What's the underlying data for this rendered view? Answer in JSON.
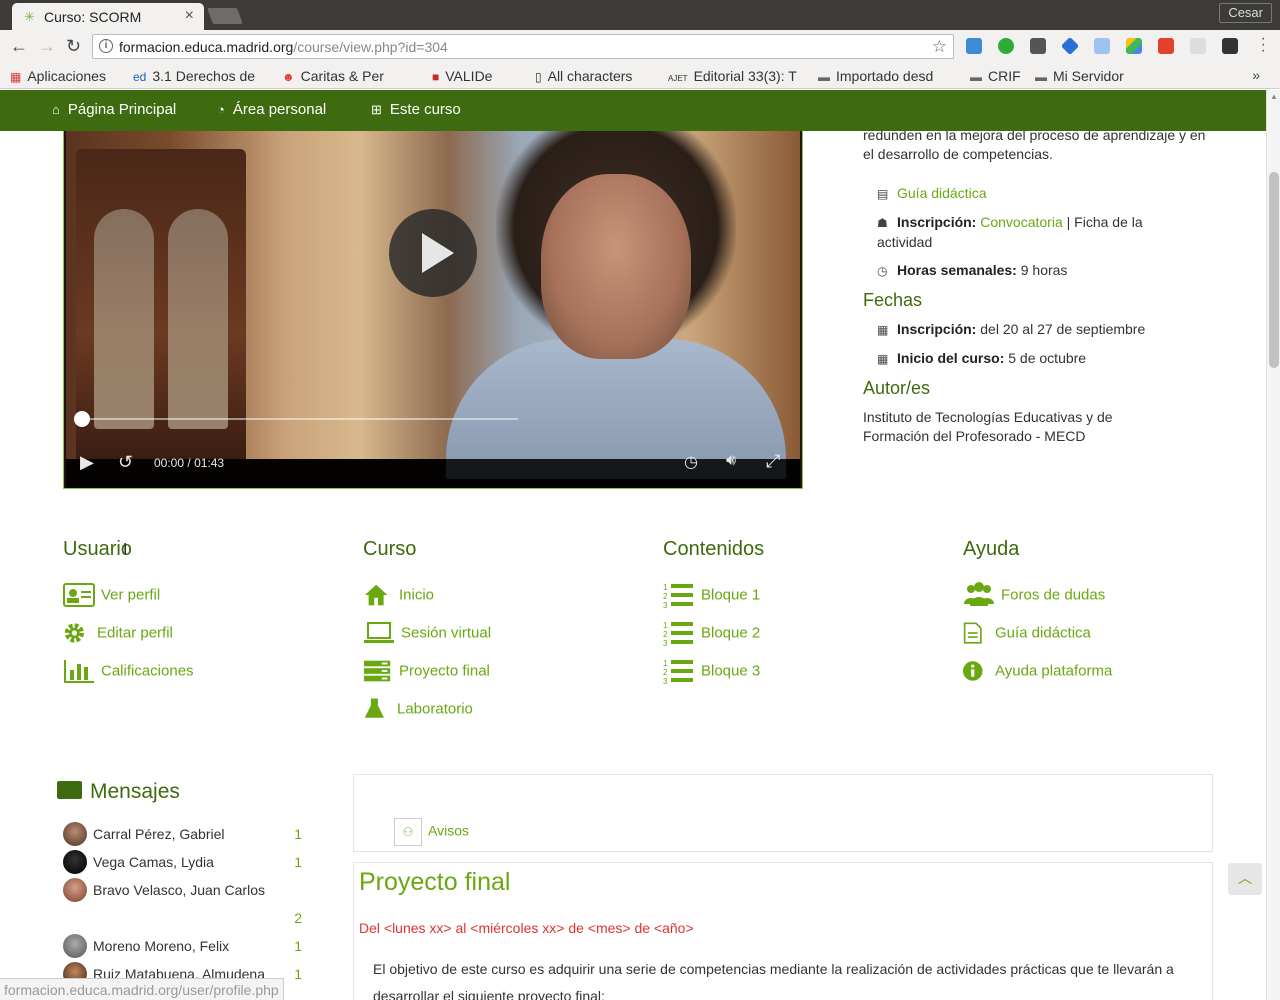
{
  "browser": {
    "tab_title": "Curso: SCORM",
    "tab_close": "×",
    "user": "Cesar",
    "url_host": "formacion.educa.madrid.org",
    "url_path": "/course/view.php?id=304",
    "bookmarks": [
      "Aplicaciones",
      "3.1 Derechos de",
      "Caritas & Per",
      "VALIDe",
      "All characters",
      "Editorial 33(3): T",
      "Importado desd",
      "CRIF",
      "Mi Servidor"
    ],
    "status_url": "formacion.educa.madrid.org/user/profile.php"
  },
  "nav": {
    "home": "Página Principal",
    "personal": "Área personal",
    "course": "Este curso"
  },
  "video": {
    "current_time": "00:00",
    "separator": "/",
    "duration": "01:43",
    "progress": 0
  },
  "info": {
    "intro": "redunden en la mejora del proceso de aprendizaje y en el desarrollo de competencias.",
    "guide_link": "Guía didáctica",
    "inscripcion_label": "Inscripción:",
    "convocatoria": "Convocatoria",
    "sep": "|",
    "ficha": "Ficha de la actividad",
    "horas_label": "Horas semanales:",
    "horas_value": "9 horas",
    "fechas_heading": "Fechas",
    "fecha_insc_label": "Inscripción:",
    "fecha_insc_value": "del 20 al 27 de septiembre",
    "inicio_label": "Inicio del curso:",
    "inicio_value": "5 de octubre",
    "autor_heading": "Autor/es",
    "autor_value": "Instituto de Tecnologías Educativas y de Formación del Profesorado - MECD"
  },
  "quicklinks": {
    "usuario": {
      "heading": "Usuario",
      "items": [
        "Ver perfil",
        "Editar perfil",
        "Calificaciones"
      ]
    },
    "curso": {
      "heading": "Curso",
      "items": [
        "Inicio",
        "Sesión virtual",
        "Proyecto final",
        "Laboratorio"
      ]
    },
    "contenidos": {
      "heading": "Contenidos",
      "items": [
        "Bloque 1",
        "Bloque 2",
        "Bloque 3"
      ]
    },
    "ayuda": {
      "heading": "Ayuda",
      "items": [
        "Foros de dudas",
        "Guía didáctica",
        "Ayuda plataforma"
      ]
    }
  },
  "messages": {
    "heading": "Mensajes",
    "rows": [
      {
        "name": "Carral Pérez, Gabriel",
        "count": "1"
      },
      {
        "name": "Vega Camas, Lydia",
        "count": "1"
      },
      {
        "name": "Bravo Velasco, Juan Carlos",
        "count": "2"
      },
      {
        "name": "Moreno Moreno, Felix",
        "count": "1"
      },
      {
        "name": "Ruiz Matabuena, Almudena",
        "count": "1"
      }
    ]
  },
  "course": {
    "avisos": "Avisos",
    "title": "Proyecto final",
    "dates": "Del <lunes xx> al <miércoles xx> de <mes> de <año>",
    "text": "El objetivo de este curso es adquirir una serie de competencias mediante la realización de actividades prácticas que te llevarán a desarrollar el siguiente proyecto final:"
  },
  "colors": {
    "nav_green": "#3e6b0f",
    "link_green": "#6aa812",
    "red": "#e03333"
  }
}
